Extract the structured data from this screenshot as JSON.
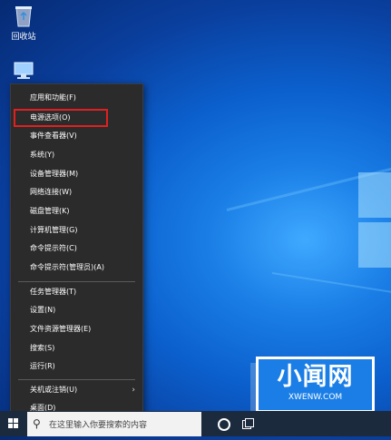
{
  "desktop": {
    "recycle_bin_label": "回收站",
    "colors": {
      "menu_bg": "#2b2b2b",
      "highlight": "#e02020",
      "taskbar": "#1c2a3e"
    }
  },
  "menu": {
    "items": [
      {
        "label": "应用和功能(F)"
      },
      {
        "label": "电源选项(O)",
        "highlighted": true
      },
      {
        "label": "事件查看器(V)"
      },
      {
        "label": "系统(Y)"
      },
      {
        "label": "设备管理器(M)"
      },
      {
        "label": "网络连接(W)"
      },
      {
        "label": "磁盘管理(K)"
      },
      {
        "label": "计算机管理(G)"
      },
      {
        "label": "命令提示符(C)"
      },
      {
        "label": "命令提示符(管理员)(A)"
      },
      {
        "label": "任务管理器(T)"
      },
      {
        "label": "设置(N)"
      },
      {
        "label": "文件资源管理器(E)"
      },
      {
        "label": "搜索(S)"
      },
      {
        "label": "运行(R)"
      },
      {
        "label": "关机或注销(U)",
        "submenu": true
      },
      {
        "label": "桌面(D)"
      }
    ]
  },
  "taskbar": {
    "search_placeholder": "在这里输入你要搜索的内容",
    "icons": [
      "windows-start-icon",
      "search-icon",
      "cortana-icon",
      "task-view-icon"
    ]
  },
  "watermark": {
    "title": "小闻网",
    "subtitle": "XWENW.COM"
  }
}
